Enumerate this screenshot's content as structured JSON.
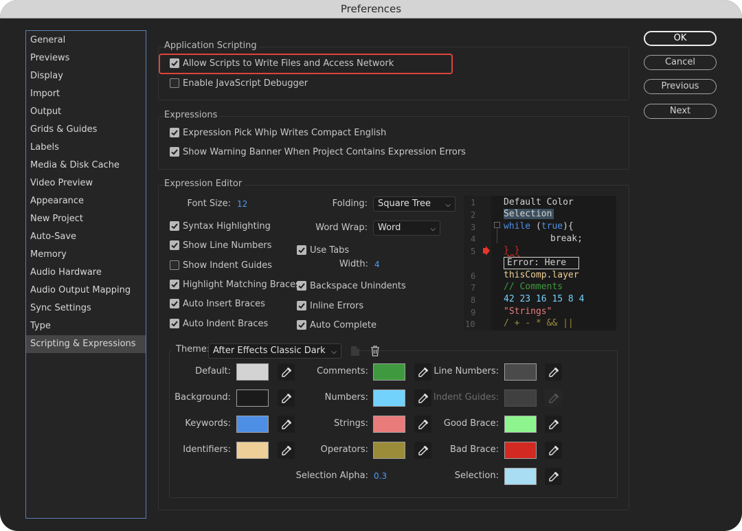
{
  "window": {
    "title": "Preferences"
  },
  "sidebar": {
    "items": [
      {
        "label": "General"
      },
      {
        "label": "Previews"
      },
      {
        "label": "Display"
      },
      {
        "label": "Import"
      },
      {
        "label": "Output"
      },
      {
        "label": "Grids & Guides"
      },
      {
        "label": "Labels"
      },
      {
        "label": "Media & Disk Cache"
      },
      {
        "label": "Video Preview"
      },
      {
        "label": "Appearance"
      },
      {
        "label": "New Project"
      },
      {
        "label": "Auto-Save"
      },
      {
        "label": "Memory"
      },
      {
        "label": "Audio Hardware"
      },
      {
        "label": "Audio Output Mapping"
      },
      {
        "label": "Sync Settings"
      },
      {
        "label": "Type"
      },
      {
        "label": "Scripting & Expressions"
      }
    ],
    "selected": "Scripting & Expressions"
  },
  "buttons": {
    "ok": "OK",
    "cancel": "Cancel",
    "previous": "Previous",
    "next": "Next"
  },
  "app_scripting": {
    "title": "Application Scripting",
    "allow_scripts": {
      "label": "Allow Scripts to Write Files and Access Network",
      "checked": true
    },
    "js_debugger": {
      "label": "Enable JavaScript Debugger",
      "checked": false
    }
  },
  "expressions": {
    "title": "Expressions",
    "pick_whip": {
      "label": "Expression Pick Whip Writes Compact English",
      "checked": true
    },
    "warning_banner": {
      "label": "Show Warning Banner When Project Contains Expression Errors",
      "checked": true
    }
  },
  "editor": {
    "title": "Expression Editor",
    "font_size_label": "Font Size:",
    "font_size_value": "12",
    "folding_label": "Folding:",
    "folding_value": "Square Tree",
    "word_wrap_label": "Word Wrap:",
    "word_wrap_value": "Word",
    "use_tabs": {
      "label": "Use Tabs",
      "checked": true
    },
    "width_label": "Width:",
    "width_value": "4",
    "syntax_highlighting": {
      "label": "Syntax Highlighting",
      "checked": true
    },
    "show_line_numbers": {
      "label": "Show Line Numbers",
      "checked": true
    },
    "show_indent_guides": {
      "label": "Show Indent Guides",
      "checked": false
    },
    "highlight_braces": {
      "label": "Highlight Matching Braces",
      "checked": true
    },
    "auto_insert_braces": {
      "label": "Auto Insert Braces",
      "checked": true
    },
    "auto_indent_braces": {
      "label": "Auto Indent Braces",
      "checked": true
    },
    "backspace_unindents": {
      "label": "Backspace Unindents",
      "checked": true
    },
    "inline_errors": {
      "label": "Inline Errors",
      "checked": true
    },
    "auto_complete": {
      "label": "Auto Complete",
      "checked": true
    }
  },
  "code_preview": {
    "line_numbers": [
      "1",
      "2",
      "3",
      "4",
      "5",
      "6",
      "7",
      "8",
      "9",
      "10"
    ],
    "lines": {
      "l1": "Default Color",
      "l2": "Selection",
      "l3_kw": "while",
      "l3_paren_open": " (",
      "l3_true": "true",
      "l3_rest": "){",
      "l4": "break;",
      "l5": "} }",
      "error": "Error: Here",
      "l6": "thisComp.layer",
      "l7": "// Comments",
      "l8": "42 23 16 15 8 4",
      "l9": "\"Strings\"",
      "l10": "/ + - * && ||"
    }
  },
  "theme": {
    "label": "Theme:",
    "value": "After Effects Classic Dark",
    "colors": {
      "default": {
        "label": "Default:",
        "color": "#d3d3d3"
      },
      "background": {
        "label": "Background:",
        "color": "#1b1b1b"
      },
      "keywords": {
        "label": "Keywords:",
        "color": "#4e8fe6"
      },
      "identifiers": {
        "label": "Identifiers:",
        "color": "#eecf97"
      },
      "comments": {
        "label": "Comments:",
        "color": "#3f9a3f"
      },
      "numbers": {
        "label": "Numbers:",
        "color": "#72d2fc"
      },
      "strings": {
        "label": "Strings:",
        "color": "#ea7b7b"
      },
      "operators": {
        "label": "Operators:",
        "color": "#9b8c3a"
      },
      "line_numbers": {
        "label": "Line Numbers:",
        "color": "#4a4a4a"
      },
      "indent_guides": {
        "label": "Indent Guides:",
        "color": "#404040"
      },
      "good_brace": {
        "label": "Good Brace:",
        "color": "#8ef58e"
      },
      "bad_brace": {
        "label": "Bad Brace:",
        "color": "#d22a22"
      },
      "selection": {
        "label": "Selection:",
        "color": "#a9ddf3"
      }
    },
    "selection_alpha_label": "Selection Alpha:",
    "selection_alpha_value": "0.3"
  },
  "icons": {
    "checkbox": "check-icon",
    "dropdown": "chevron-down-icon",
    "eyedropper": "eyedropper-icon",
    "new_theme": "new-document-icon",
    "delete_theme": "trash-icon",
    "error_marker": "arrow-right-icon"
  },
  "accent": {
    "value_blue": "#4f9bf5",
    "annotation_red": "#e0433a"
  }
}
